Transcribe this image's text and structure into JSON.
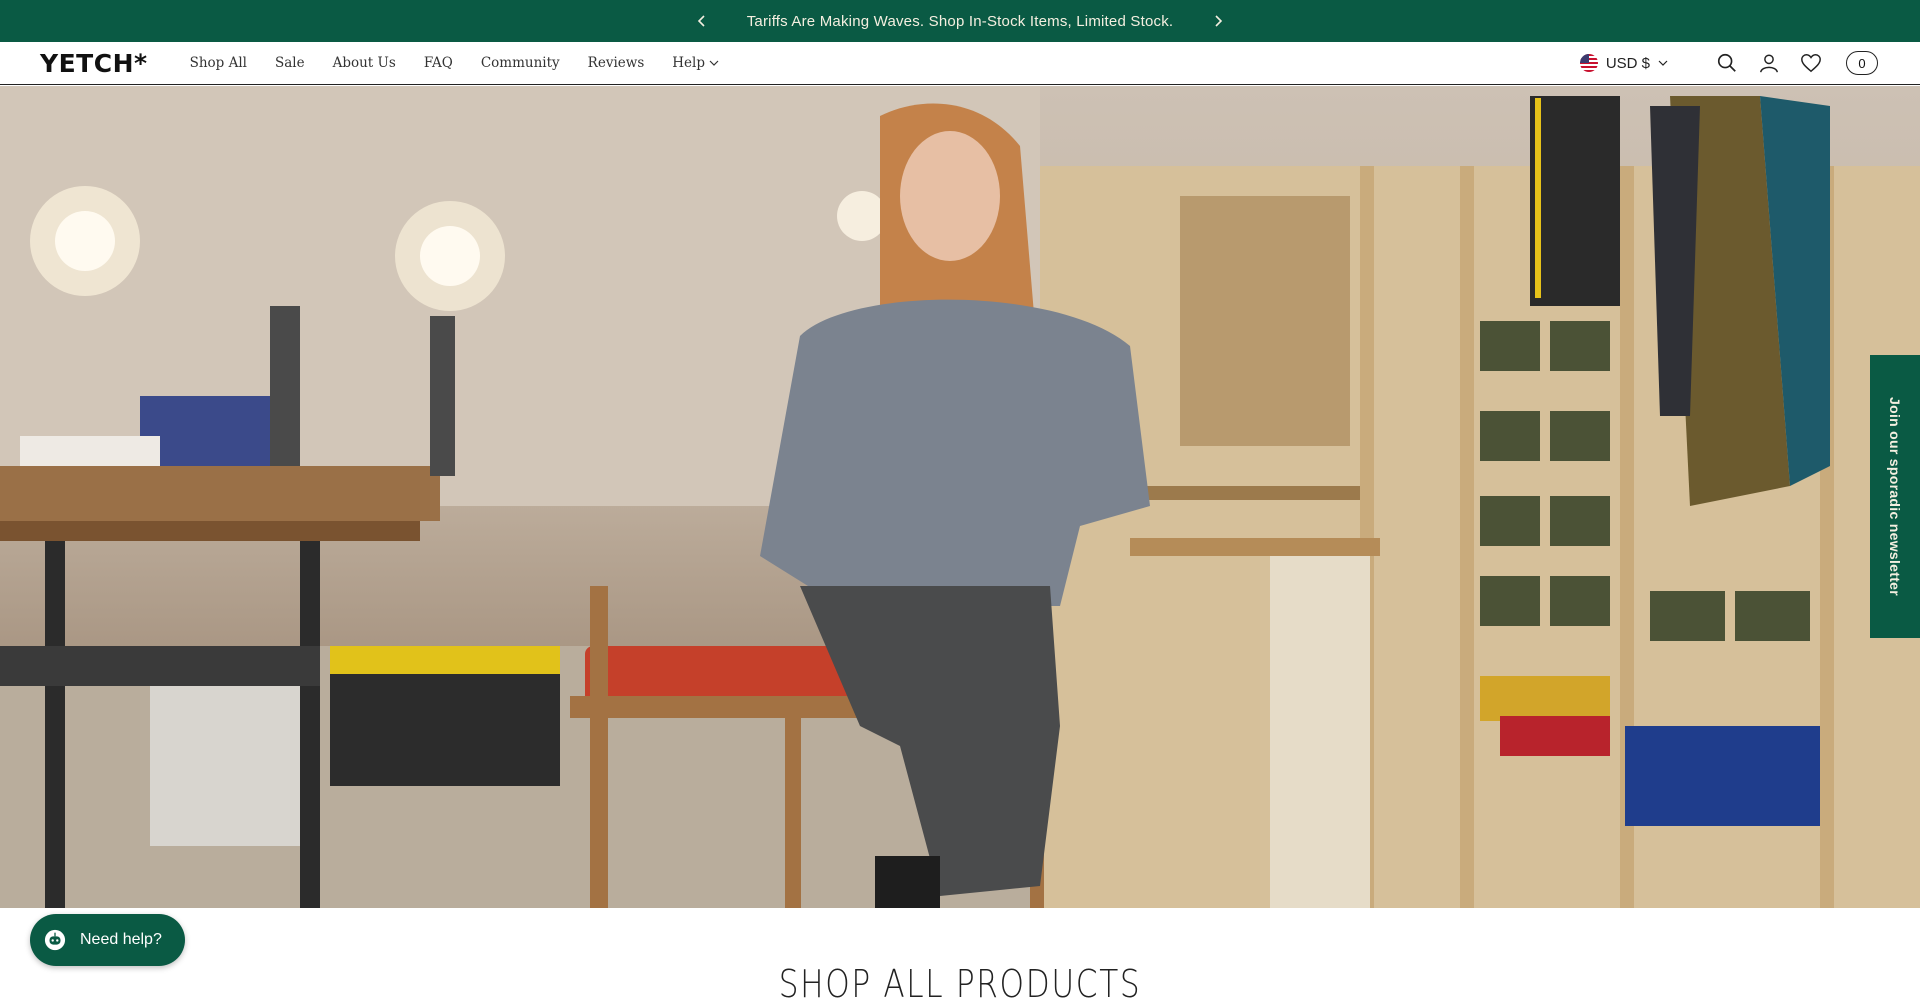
{
  "announcement": {
    "message": "Tariffs Are Making Waves. Shop In-Stock Items, Limited Stock."
  },
  "header": {
    "logo": "YETCH*",
    "nav": [
      {
        "label": "Shop All"
      },
      {
        "label": "Sale"
      },
      {
        "label": "About Us"
      },
      {
        "label": "FAQ"
      },
      {
        "label": "Community"
      },
      {
        "label": "Reviews"
      },
      {
        "label": "Help"
      }
    ],
    "currency": "USD $",
    "cart_count": "0"
  },
  "newsletter_tab": {
    "label": "Join our sporadic newsletter"
  },
  "help_button": {
    "label": "Need help?"
  },
  "section": {
    "title": "SHOP ALL PRODUCTS"
  },
  "colors": {
    "brand_green": "#0a5a44",
    "announcement_text": "#f4efe0"
  }
}
